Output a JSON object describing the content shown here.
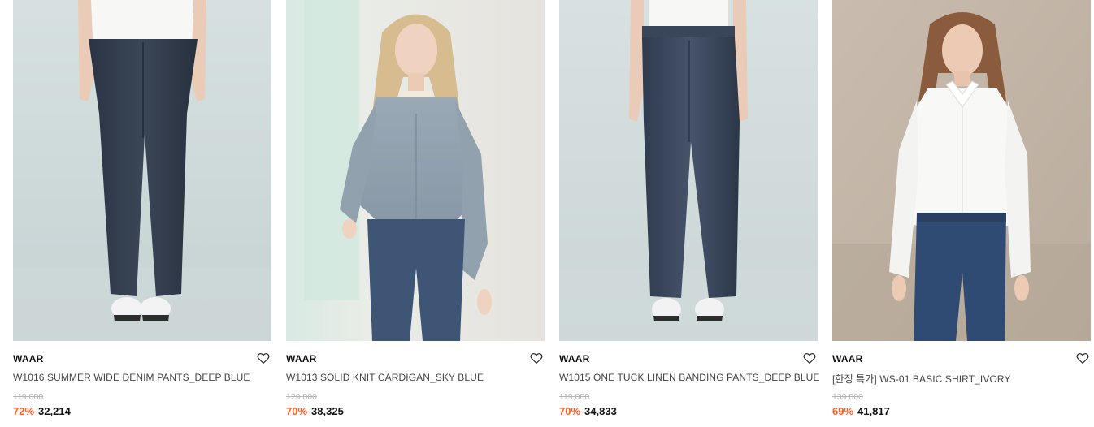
{
  "products": [
    {
      "brand": "WAAR",
      "name": "W1016 SUMMER WIDE DENIM PANTS_DEEP BLUE",
      "original_price": "119,000",
      "discount": "72%",
      "price": "32,214",
      "image": "model-wide-denim-pants",
      "icon": "heart-outline-icon"
    },
    {
      "brand": "WAAR",
      "name": "W1013 SOLID KNIT CARDIGAN_SKY BLUE",
      "original_price": "129,000",
      "discount": "70%",
      "price": "38,325",
      "image": "model-sky-blue-cardigan",
      "icon": "heart-outline-icon"
    },
    {
      "brand": "WAAR",
      "name": "W1015 ONE TUCK LINEN BANDING PANTS_DEEP BLUE",
      "original_price": "119,000",
      "discount": "70%",
      "price": "34,833",
      "image": "model-banding-pants",
      "icon": "heart-outline-icon"
    },
    {
      "brand": "WAAR",
      "name": "[한정 특가] WS-01 BASIC SHIRT_IVORY",
      "original_price": "139,000",
      "discount": "69%",
      "price": "41,817",
      "image": "model-ivory-shirt",
      "icon": "heart-outline-icon"
    }
  ],
  "colors": {
    "discount": "#ff5a1f",
    "text": "#111111",
    "name": "#444444",
    "original_price": "#b5b5b5"
  }
}
